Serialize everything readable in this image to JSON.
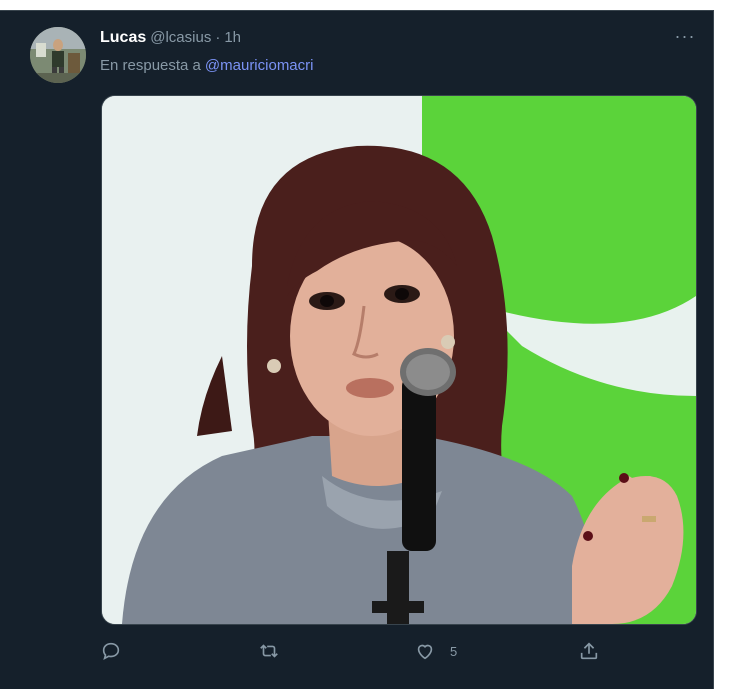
{
  "tweet": {
    "author_name": "Lucas",
    "author_handle": "@lcasius",
    "separator": "·",
    "time": "1h",
    "reply_prefix": "En respuesta a",
    "reply_to": "@mauriciomacri",
    "more_label": "···"
  },
  "actions": {
    "reply_icon": "comment-icon",
    "retweet_icon": "retweet-icon",
    "like_icon": "heart-icon",
    "like_count": "5",
    "share_icon": "share-icon"
  },
  "colors": {
    "background": "#15202b",
    "secondary_text": "#8899a6",
    "mention": "#7b93f5",
    "border": "#38444d"
  }
}
